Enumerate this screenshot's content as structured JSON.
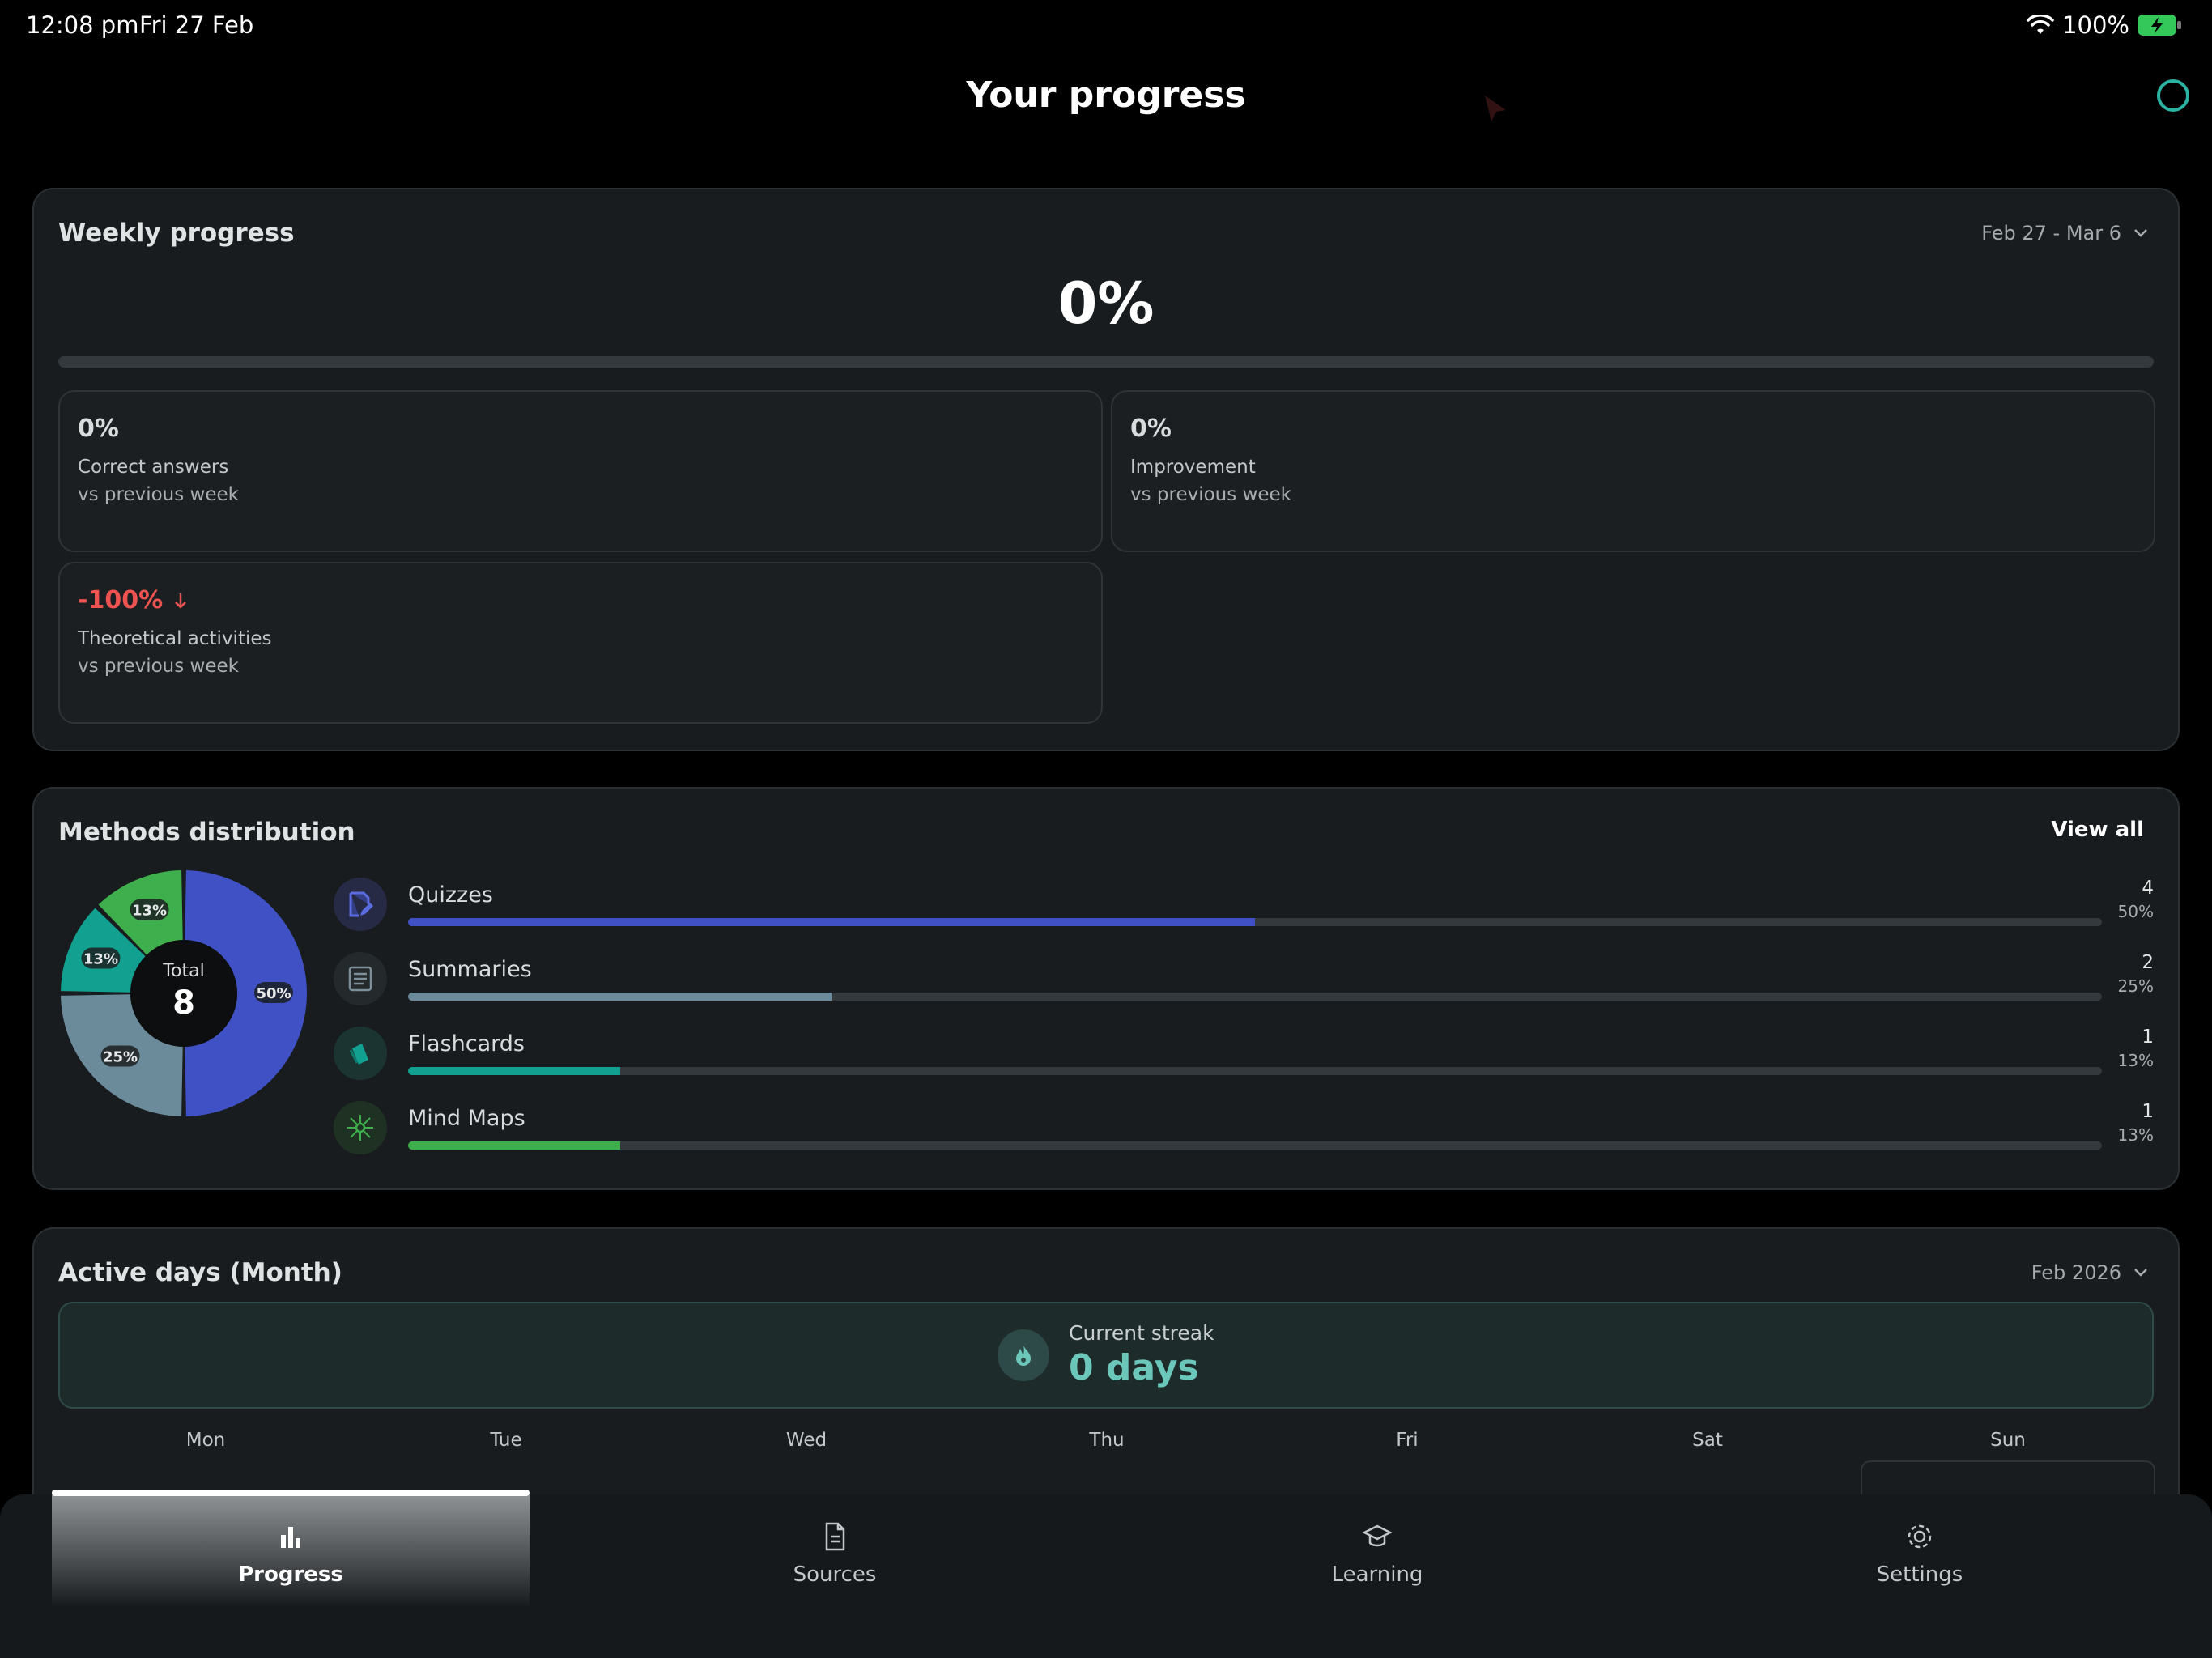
{
  "status_bar": {
    "time": "12:08 pm",
    "date": "Fri 27 Feb",
    "battery": "100%"
  },
  "page": {
    "title": "Your progress"
  },
  "weekly": {
    "title": "Weekly progress",
    "range": "Feb 27 - Mar 6",
    "overall": "0%",
    "overall_progress": 0,
    "stats": [
      {
        "value": "0%",
        "label": "Correct answers",
        "sub": "vs previous week"
      },
      {
        "value": "0%",
        "label": "Improvement",
        "sub": "vs previous week"
      },
      {
        "value": "-100%",
        "label": "Theoretical activities",
        "sub": "vs previous week",
        "trend": "down"
      }
    ]
  },
  "methods": {
    "title": "Methods distribution",
    "view_all": "View all",
    "total_label": "Total",
    "total": "8",
    "items": [
      {
        "name": "Quizzes",
        "count": "4",
        "pct": "50%",
        "fraction": 0.5,
        "color": "#3f51c4",
        "icon": "quiz-edit-icon"
      },
      {
        "name": "Summaries",
        "count": "2",
        "pct": "25%",
        "fraction": 0.25,
        "color": "#6b8a9a",
        "icon": "document-lines-icon"
      },
      {
        "name": "Flashcards",
        "count": "1",
        "pct": "13%",
        "fraction": 0.125,
        "color": "#12a191",
        "icon": "cards-icon"
      },
      {
        "name": "Mind Maps",
        "count": "1",
        "pct": "13%",
        "fraction": 0.125,
        "color": "#3fae4c",
        "icon": "network-icon"
      }
    ]
  },
  "active_days": {
    "title": "Active days (Month)",
    "month": "Feb 2026",
    "streak_label": "Current streak",
    "streak_value": "0 days",
    "weekdays": [
      "Mon",
      "Tue",
      "Wed",
      "Thu",
      "Fri",
      "Sat",
      "Sun"
    ]
  },
  "nav": [
    {
      "label": "Progress",
      "icon": "bar-chart-icon",
      "active": true
    },
    {
      "label": "Sources",
      "icon": "file-icon",
      "active": false
    },
    {
      "label": "Learning",
      "icon": "graduation-cap-icon",
      "active": false
    },
    {
      "label": "Settings",
      "icon": "gear-icon",
      "active": false
    }
  ]
}
